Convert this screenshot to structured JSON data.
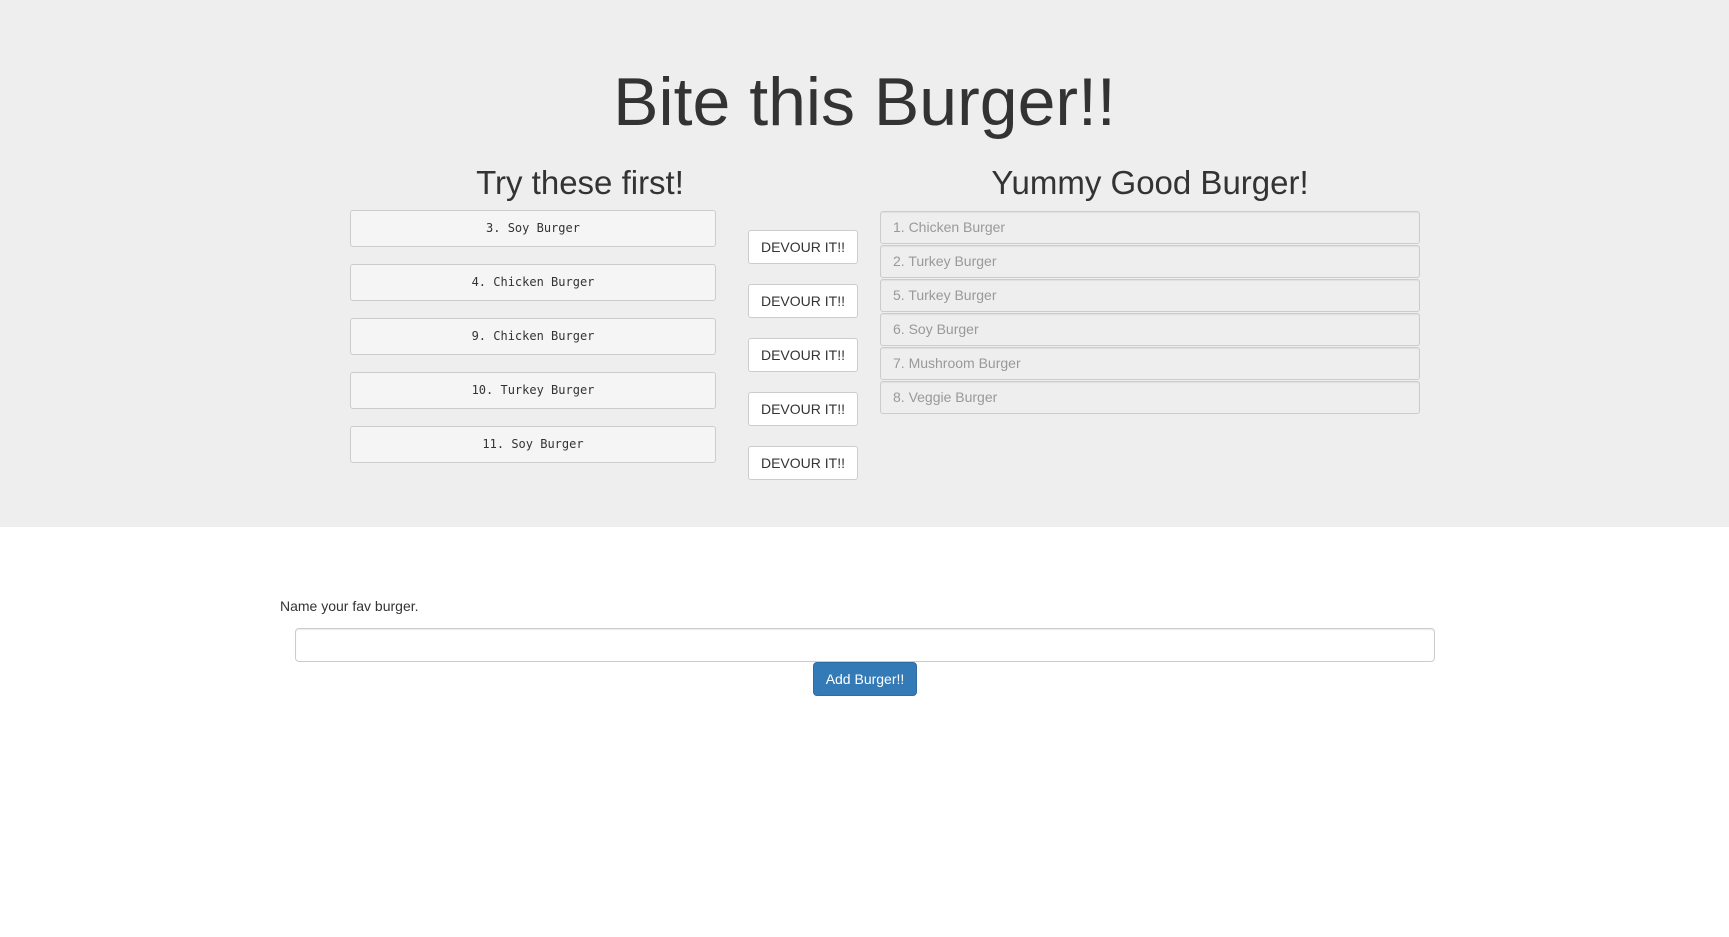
{
  "header": {
    "title": "Bite this Burger!!"
  },
  "pending": {
    "title": "Try these first!",
    "devour_label": "DEVOUR IT!!",
    "items": [
      "3. Soy Burger",
      "4. Chicken Burger",
      "9. Chicken Burger",
      "10. Turkey Burger",
      "11. Soy Burger"
    ]
  },
  "devoured": {
    "title": "Yummy Good Burger!",
    "items": [
      "1. Chicken Burger",
      "2. Turkey Burger",
      "5. Turkey Burger",
      "6. Soy Burger",
      "7. Mushroom Burger",
      "8. Veggie Burger"
    ]
  },
  "form": {
    "label": "Name your fav burger.",
    "input_value": "",
    "submit_label": "Add Burger!!"
  },
  "colors": {
    "jumbotron_bg": "#eeeeee",
    "primary": "#337ab7"
  }
}
